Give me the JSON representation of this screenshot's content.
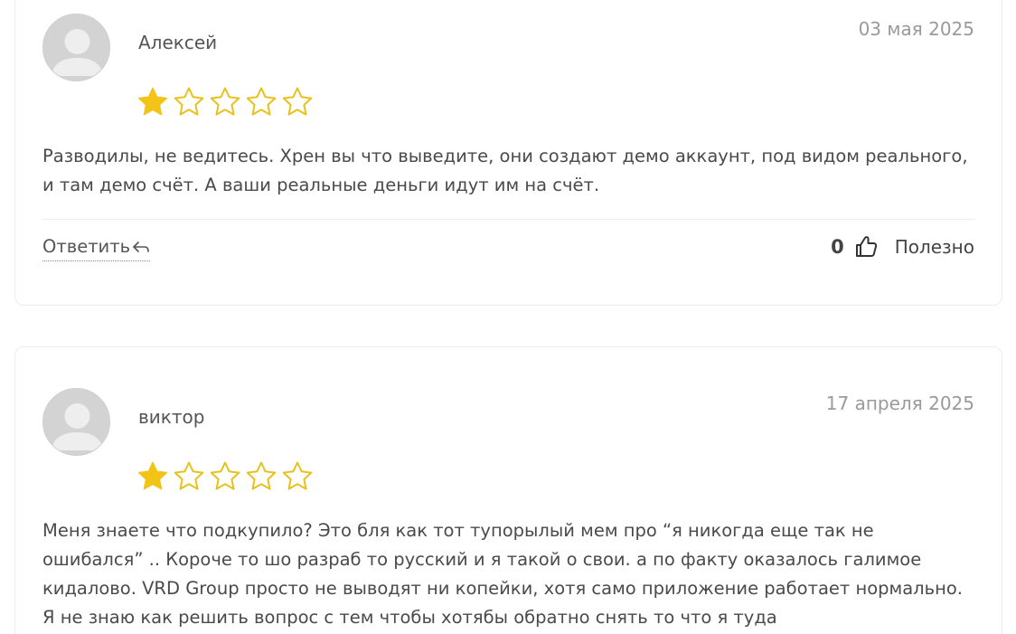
{
  "colors": {
    "star_filled": "#F2C418",
    "star_outline": "#E8C11C",
    "avatar_bg": "#D3D3D3",
    "avatar_figure": "#EEEEEE"
  },
  "reviews": [
    {
      "author": "Алексей",
      "date": "03 мая 2025",
      "rating": 1,
      "max_rating": 5,
      "text": "Разводилы, не ведитесь. Хрен вы что выведите, они создают демо аккаунт, под видом реального, и там демо счёт. А ваши реальные деньги идут им на счёт.",
      "reply_label": "Ответить",
      "reply_icon": "reply-arrow-icon",
      "helpful_count": "0",
      "helpful_icon": "thumbs-up-icon",
      "helpful_label": "Полезно"
    },
    {
      "author": "виктор",
      "date": "17 апреля 2025",
      "rating": 1,
      "max_rating": 5,
      "text": "Меня знаете что подкупило? Это бля как тот тупорылый мем про “я никогда еще так не ошибался” .. Короче то шо разраб то русский и я такой о свои. а по факту оказалось галимое кидалово. VRD Group просто не выводят ни копейки, хотя само приложение работает нормально. Я не знаю как решить вопрос с тем чтобы хотябы обратно снять то что я туда"
    }
  ]
}
